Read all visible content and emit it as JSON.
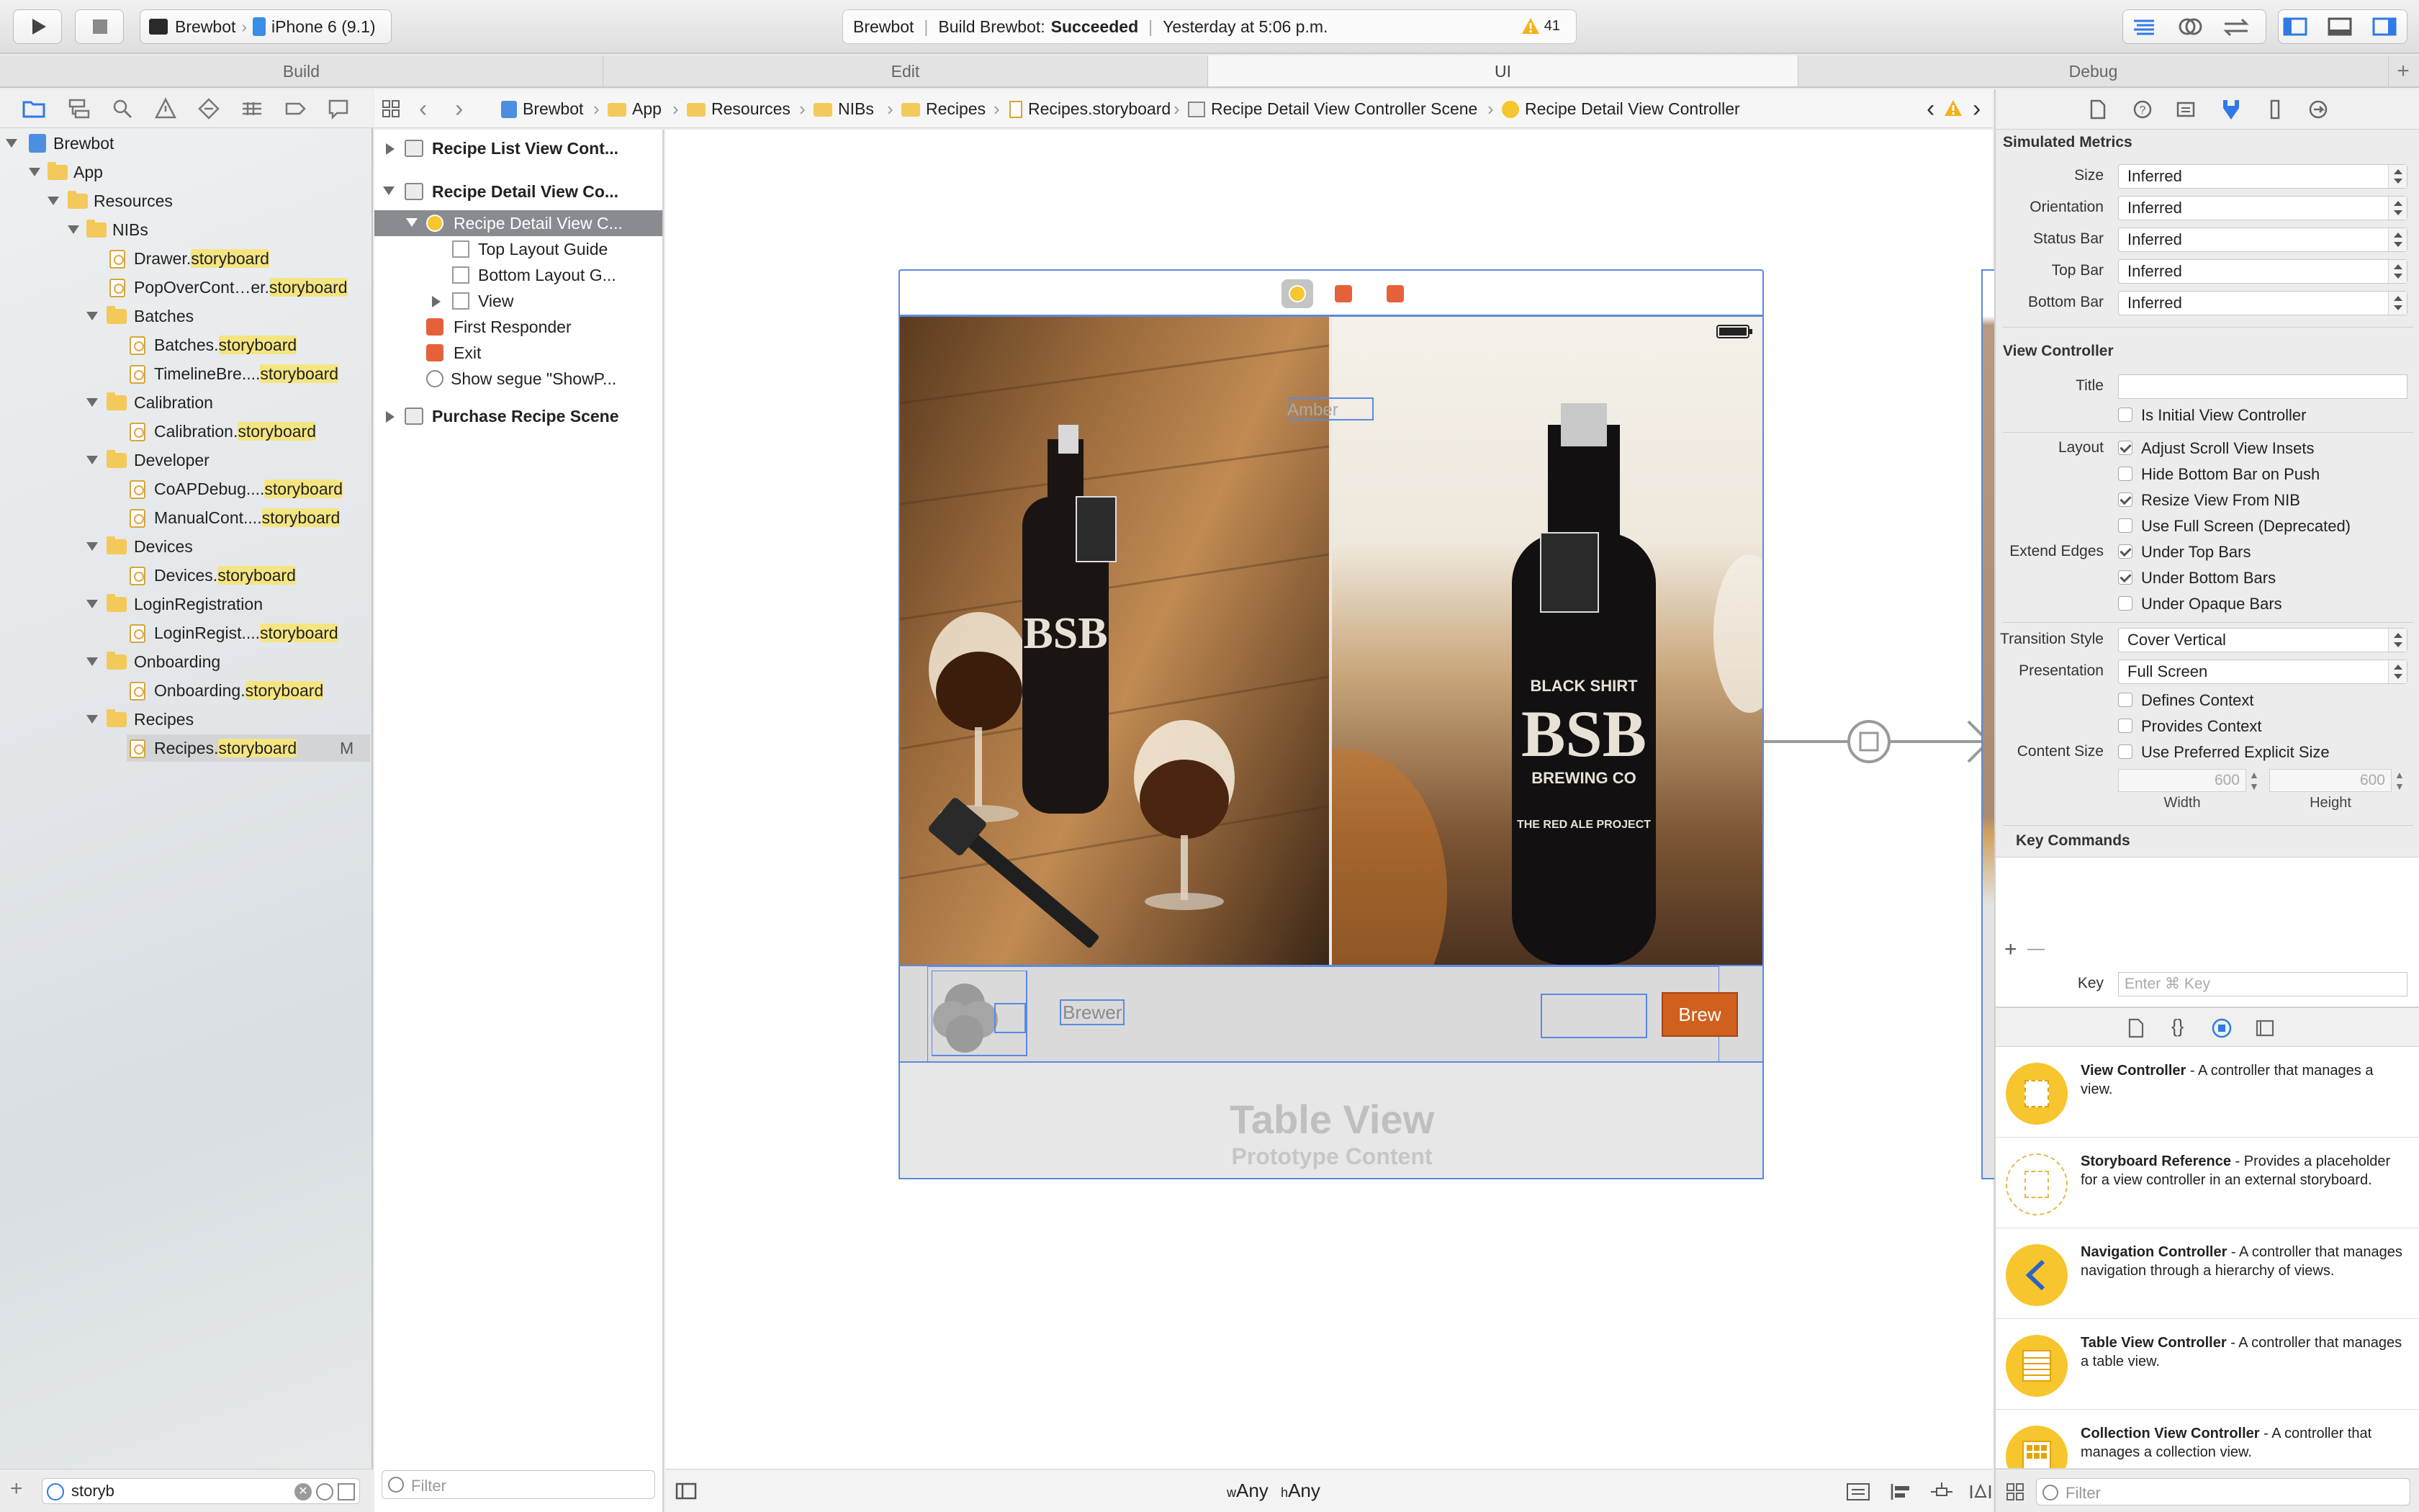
{
  "toolbar": {
    "scheme": "Brewbot",
    "device": "iPhone 6 (9.1)",
    "activity_project": "Brewbot",
    "activity_status_prefix": "Build Brewbot:",
    "activity_status": "Succeeded",
    "activity_time": "Yesterday at 5:06 p.m.",
    "warning_count": "41"
  },
  "tabs": [
    "Build",
    "Edit",
    "UI",
    "Debug"
  ],
  "navigator": {
    "tree": [
      {
        "label": "Brewbot"
      },
      {
        "label": "App"
      },
      {
        "label": "Resources"
      },
      {
        "label": "NIBs"
      },
      {
        "pre": "Drawer.",
        "hl": "storyboard",
        "post": ""
      },
      {
        "pre": "PopOverCont…er.",
        "hl": "storyboard",
        "post": ""
      },
      {
        "label": "Batches"
      },
      {
        "pre": "Batches.",
        "hl": "storyboard",
        "post": ""
      },
      {
        "pre": "TimelineBre....",
        "hl": "storyboard",
        "post": ""
      },
      {
        "label": "Calibration"
      },
      {
        "pre": "Calibration.",
        "hl": "storyboard",
        "post": ""
      },
      {
        "label": "Developer"
      },
      {
        "pre": "CoAPDebug....",
        "hl": "storyboard",
        "post": ""
      },
      {
        "pre": "ManualCont....",
        "hl": "storyboard",
        "post": ""
      },
      {
        "label": "Devices"
      },
      {
        "pre": "Devices.",
        "hl": "storyboard",
        "post": ""
      },
      {
        "label": "LoginRegistration"
      },
      {
        "pre": "LoginRegist....",
        "hl": "storyboard",
        "post": ""
      },
      {
        "label": "Onboarding"
      },
      {
        "pre": "Onboarding.",
        "hl": "storyboard",
        "post": ""
      },
      {
        "label": "Recipes"
      },
      {
        "pre": "Recipes.",
        "hl": "storyboard",
        "post": "",
        "badge": "M"
      }
    ],
    "filter_value": "storyb"
  },
  "jumpbar": [
    "Brewbot",
    "App",
    "Resources",
    "NIBs",
    "Recipes",
    "Recipes.storyboard",
    "Recipe Detail View Controller Scene",
    "Recipe Detail View Controller"
  ],
  "outline": {
    "items": [
      "Recipe List View Cont...",
      "Recipe Detail View Co...",
      "Recipe Detail View C...",
      "Top Layout Guide",
      "Bottom Layout G...",
      "View",
      "First Responder",
      "Exit",
      "Show segue \"ShowP...",
      "Purchase Recipe Scene"
    ],
    "filter_placeholder": "Filter"
  },
  "canvas": {
    "label_amber": "Amber",
    "label_brewer": "Brewer",
    "brew_button": "Brew",
    "table_view_title": "Table View",
    "table_view_subtitle": "Prototype Content",
    "bottle_brand": "BSB",
    "bottle_sub": "BLACK SHIRT",
    "bottle_sub2": "BREWING CO",
    "bottle_note": "THE RED ALE PROJECT",
    "size_w_prefix": "w",
    "size_w": "Any",
    "size_h_prefix": "h",
    "size_h": "Any"
  },
  "inspector": {
    "simulated_metrics": "Simulated Metrics",
    "metrics": [
      {
        "label": "Size",
        "value": "Inferred"
      },
      {
        "label": "Orientation",
        "value": "Inferred"
      },
      {
        "label": "Status Bar",
        "value": "Inferred"
      },
      {
        "label": "Top Bar",
        "value": "Inferred"
      },
      {
        "label": "Bottom Bar",
        "value": "Inferred"
      }
    ],
    "view_controller": "View Controller",
    "title_label": "Title",
    "is_initial": "Is Initial View Controller",
    "layout_label": "Layout",
    "adjust_insets": "Adjust Scroll View Insets",
    "hide_bottom": "Hide Bottom Bar on Push",
    "resize_nib": "Resize View From NIB",
    "full_screen": "Use Full Screen (Deprecated)",
    "extend_label": "Extend Edges",
    "under_top": "Under Top Bars",
    "under_bottom": "Under Bottom Bars",
    "under_opaque": "Under Opaque Bars",
    "transition_label": "Transition Style",
    "transition_value": "Cover Vertical",
    "presentation_label": "Presentation",
    "presentation_value": "Full Screen",
    "defines_context": "Defines Context",
    "provides_context": "Provides Context",
    "content_size_label": "Content Size",
    "preferred_size": "Use Preferred Explicit Size",
    "width_value": "600",
    "height_value": "600",
    "width_label": "Width",
    "height_label": "Height",
    "key_commands": "Key Commands",
    "plus": "+",
    "minus": "—",
    "key_label": "Key",
    "key_placeholder": "Enter ⌘ Key",
    "library": [
      {
        "name": "View Controller",
        "desc": " - A controller that manages a view."
      },
      {
        "name": "Storyboard Reference",
        "desc": " - Provides a placeholder for a view controller in an external storyboard."
      },
      {
        "name": "Navigation Controller",
        "desc": " - A controller that manages navigation through a hierarchy of views."
      },
      {
        "name": "Table View Controller",
        "desc": " - A controller that manages a table view."
      },
      {
        "name": "Collection View Controller",
        "desc": " - A controller that manages a collection view."
      }
    ],
    "library_filter_placeholder": "Filter"
  },
  "colors": {
    "accent": "#2f7ae5",
    "brew_button": "#d0601d",
    "library_icon": "#f7c52d",
    "highlight": "#f5e582"
  }
}
